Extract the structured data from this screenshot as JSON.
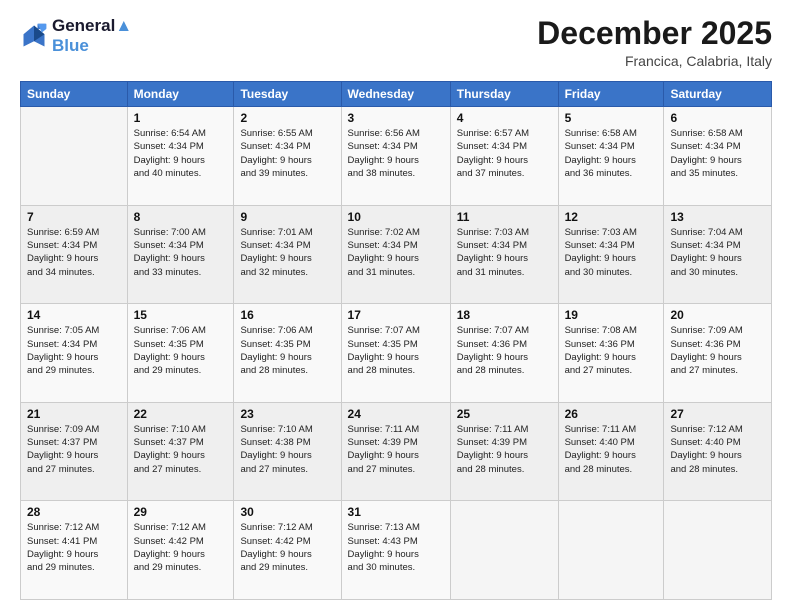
{
  "logo": {
    "line1": "General",
    "line2": "Blue"
  },
  "title": "December 2025",
  "location": "Francica, Calabria, Italy",
  "header_days": [
    "Sunday",
    "Monday",
    "Tuesday",
    "Wednesday",
    "Thursday",
    "Friday",
    "Saturday"
  ],
  "weeks": [
    [
      {
        "day": "",
        "info": ""
      },
      {
        "day": "1",
        "info": "Sunrise: 6:54 AM\nSunset: 4:34 PM\nDaylight: 9 hours\nand 40 minutes."
      },
      {
        "day": "2",
        "info": "Sunrise: 6:55 AM\nSunset: 4:34 PM\nDaylight: 9 hours\nand 39 minutes."
      },
      {
        "day": "3",
        "info": "Sunrise: 6:56 AM\nSunset: 4:34 PM\nDaylight: 9 hours\nand 38 minutes."
      },
      {
        "day": "4",
        "info": "Sunrise: 6:57 AM\nSunset: 4:34 PM\nDaylight: 9 hours\nand 37 minutes."
      },
      {
        "day": "5",
        "info": "Sunrise: 6:58 AM\nSunset: 4:34 PM\nDaylight: 9 hours\nand 36 minutes."
      },
      {
        "day": "6",
        "info": "Sunrise: 6:58 AM\nSunset: 4:34 PM\nDaylight: 9 hours\nand 35 minutes."
      }
    ],
    [
      {
        "day": "7",
        "info": "Sunrise: 6:59 AM\nSunset: 4:34 PM\nDaylight: 9 hours\nand 34 minutes."
      },
      {
        "day": "8",
        "info": "Sunrise: 7:00 AM\nSunset: 4:34 PM\nDaylight: 9 hours\nand 33 minutes."
      },
      {
        "day": "9",
        "info": "Sunrise: 7:01 AM\nSunset: 4:34 PM\nDaylight: 9 hours\nand 32 minutes."
      },
      {
        "day": "10",
        "info": "Sunrise: 7:02 AM\nSunset: 4:34 PM\nDaylight: 9 hours\nand 31 minutes."
      },
      {
        "day": "11",
        "info": "Sunrise: 7:03 AM\nSunset: 4:34 PM\nDaylight: 9 hours\nand 31 minutes."
      },
      {
        "day": "12",
        "info": "Sunrise: 7:03 AM\nSunset: 4:34 PM\nDaylight: 9 hours\nand 30 minutes."
      },
      {
        "day": "13",
        "info": "Sunrise: 7:04 AM\nSunset: 4:34 PM\nDaylight: 9 hours\nand 30 minutes."
      }
    ],
    [
      {
        "day": "14",
        "info": "Sunrise: 7:05 AM\nSunset: 4:34 PM\nDaylight: 9 hours\nand 29 minutes."
      },
      {
        "day": "15",
        "info": "Sunrise: 7:06 AM\nSunset: 4:35 PM\nDaylight: 9 hours\nand 29 minutes."
      },
      {
        "day": "16",
        "info": "Sunrise: 7:06 AM\nSunset: 4:35 PM\nDaylight: 9 hours\nand 28 minutes."
      },
      {
        "day": "17",
        "info": "Sunrise: 7:07 AM\nSunset: 4:35 PM\nDaylight: 9 hours\nand 28 minutes."
      },
      {
        "day": "18",
        "info": "Sunrise: 7:07 AM\nSunset: 4:36 PM\nDaylight: 9 hours\nand 28 minutes."
      },
      {
        "day": "19",
        "info": "Sunrise: 7:08 AM\nSunset: 4:36 PM\nDaylight: 9 hours\nand 27 minutes."
      },
      {
        "day": "20",
        "info": "Sunrise: 7:09 AM\nSunset: 4:36 PM\nDaylight: 9 hours\nand 27 minutes."
      }
    ],
    [
      {
        "day": "21",
        "info": "Sunrise: 7:09 AM\nSunset: 4:37 PM\nDaylight: 9 hours\nand 27 minutes."
      },
      {
        "day": "22",
        "info": "Sunrise: 7:10 AM\nSunset: 4:37 PM\nDaylight: 9 hours\nand 27 minutes."
      },
      {
        "day": "23",
        "info": "Sunrise: 7:10 AM\nSunset: 4:38 PM\nDaylight: 9 hours\nand 27 minutes."
      },
      {
        "day": "24",
        "info": "Sunrise: 7:11 AM\nSunset: 4:39 PM\nDaylight: 9 hours\nand 27 minutes."
      },
      {
        "day": "25",
        "info": "Sunrise: 7:11 AM\nSunset: 4:39 PM\nDaylight: 9 hours\nand 28 minutes."
      },
      {
        "day": "26",
        "info": "Sunrise: 7:11 AM\nSunset: 4:40 PM\nDaylight: 9 hours\nand 28 minutes."
      },
      {
        "day": "27",
        "info": "Sunrise: 7:12 AM\nSunset: 4:40 PM\nDaylight: 9 hours\nand 28 minutes."
      }
    ],
    [
      {
        "day": "28",
        "info": "Sunrise: 7:12 AM\nSunset: 4:41 PM\nDaylight: 9 hours\nand 29 minutes."
      },
      {
        "day": "29",
        "info": "Sunrise: 7:12 AM\nSunset: 4:42 PM\nDaylight: 9 hours\nand 29 minutes."
      },
      {
        "day": "30",
        "info": "Sunrise: 7:12 AM\nSunset: 4:42 PM\nDaylight: 9 hours\nand 29 minutes."
      },
      {
        "day": "31",
        "info": "Sunrise: 7:13 AM\nSunset: 4:43 PM\nDaylight: 9 hours\nand 30 minutes."
      },
      {
        "day": "",
        "info": ""
      },
      {
        "day": "",
        "info": ""
      },
      {
        "day": "",
        "info": ""
      }
    ]
  ]
}
